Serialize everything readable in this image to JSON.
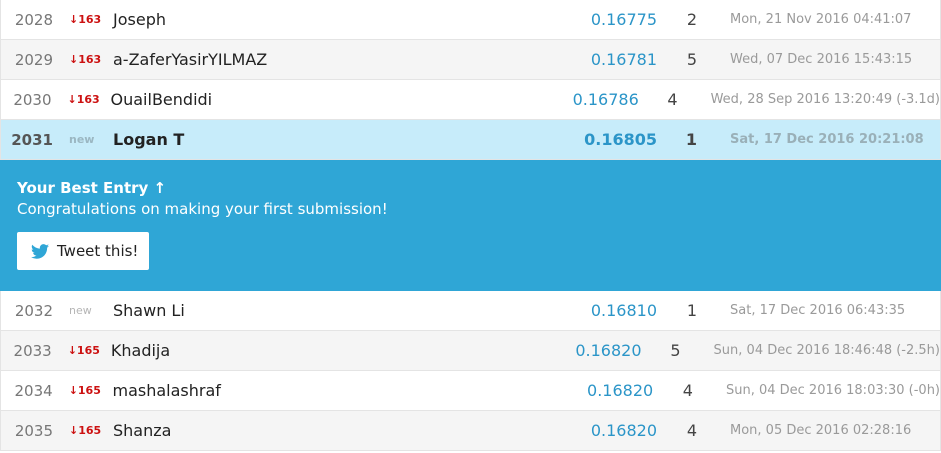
{
  "rows_before": [
    {
      "rank": "2028",
      "delta": "↓163",
      "team": "Joseph",
      "score": "0.16775",
      "entries": "2",
      "last": "Mon, 21 Nov 2016 04:41:07"
    },
    {
      "rank": "2029",
      "delta": "↓163",
      "team": "a-ZaferYasirYILMAZ",
      "score": "0.16781",
      "entries": "5",
      "last": "Wed, 07 Dec 2016 15:43:15"
    },
    {
      "rank": "2030",
      "delta": "↓163",
      "team": "OuailBendidi",
      "score": "0.16786",
      "entries": "4",
      "last": "Wed, 28 Sep 2016 13:20:49 (-3.1d)"
    }
  ],
  "my_row": {
    "rank": "2031",
    "delta": "new",
    "team": "Logan T",
    "score": "0.16805",
    "entries": "1",
    "last": "Sat, 17 Dec 2016 20:21:08"
  },
  "best_entry": {
    "title": "Your Best Entry ↑",
    "message": "Congratulations on making your first submission!",
    "tweet_label": "Tweet this!"
  },
  "rows_after": [
    {
      "rank": "2032",
      "delta": "new",
      "team": "Shawn Li",
      "score": "0.16810",
      "entries": "1",
      "last": "Sat, 17 Dec 2016 06:43:35"
    },
    {
      "rank": "2033",
      "delta": "↓165",
      "team": "Khadija",
      "score": "0.16820",
      "entries": "5",
      "last": "Sun, 04 Dec 2016 18:46:48 (-2.5h)"
    },
    {
      "rank": "2034",
      "delta": "↓165",
      "team": "mashalashraf",
      "score": "0.16820",
      "entries": "4",
      "last": "Sun, 04 Dec 2016 18:03:30 (-0h)"
    },
    {
      "rank": "2035",
      "delta": "↓165",
      "team": "Shanza",
      "score": "0.16820",
      "entries": "4",
      "last": "Mon, 05 Dec 2016 02:28:16"
    }
  ],
  "colors": {
    "accent": "#2fa6d6",
    "highlight": "#c7ecfa",
    "score": "#2b95c8",
    "drop": "#cc1111"
  },
  "icons": {
    "tweet": "twitter-bird-icon"
  }
}
